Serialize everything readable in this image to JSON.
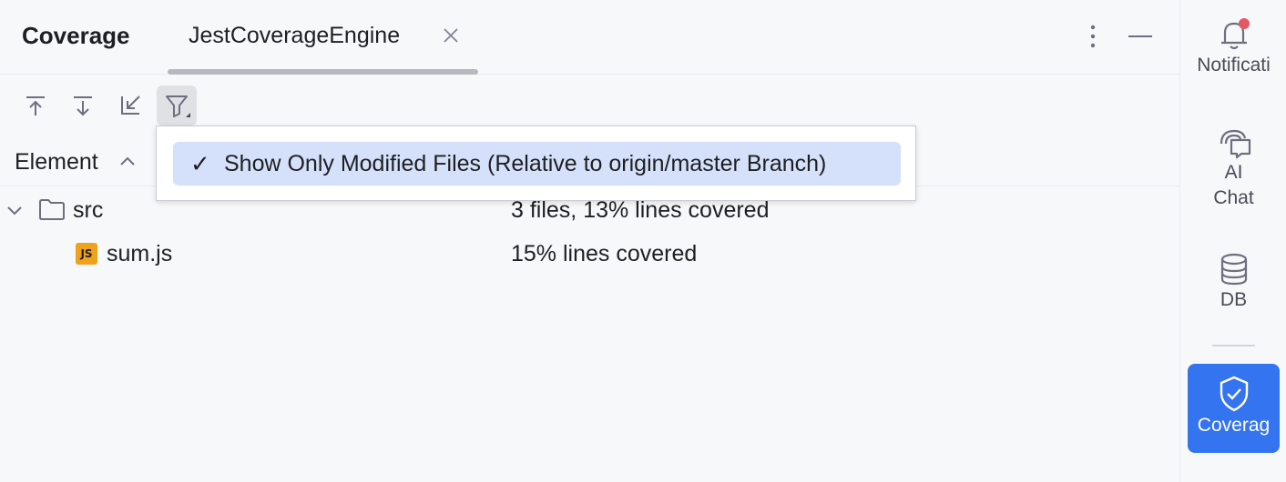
{
  "header": {
    "title": "Coverage",
    "tab_label": "JestCoverageEngine",
    "more_icon": "more-vertical-icon",
    "minimize_icon": "minimize-icon"
  },
  "toolbar": {
    "buttons": [
      {
        "icon": "import-icon"
      },
      {
        "icon": "export-icon"
      },
      {
        "icon": "collapse-arrow-icon"
      },
      {
        "icon": "filter-icon",
        "active": true
      }
    ]
  },
  "table": {
    "column_element": "Element",
    "rows": [
      {
        "name": "src",
        "coverage": "3 files, 13% lines covered",
        "type": "folder",
        "expanded": true
      },
      {
        "name": "sum.js",
        "coverage": "15% lines covered",
        "type": "js-file",
        "badge": "JS"
      }
    ]
  },
  "popup": {
    "check": "✓",
    "label": "Show Only Modified Files (Relative to origin/master Branch)"
  },
  "sidebar": {
    "items": [
      {
        "label": "Notificati",
        "icon": "bell-icon"
      },
      {
        "label_line1": "AI",
        "label_line2": "Chat",
        "icon": "ai-chat-icon"
      },
      {
        "label": "DB",
        "icon": "database-icon"
      },
      {
        "label": "Coverag",
        "icon": "shield-check-icon",
        "selected": true
      }
    ]
  },
  "colors": {
    "accent": "#3574f0",
    "selection": "#d5e1fb",
    "notification_dot": "#e55765",
    "js_badge": "#f0a21a"
  }
}
